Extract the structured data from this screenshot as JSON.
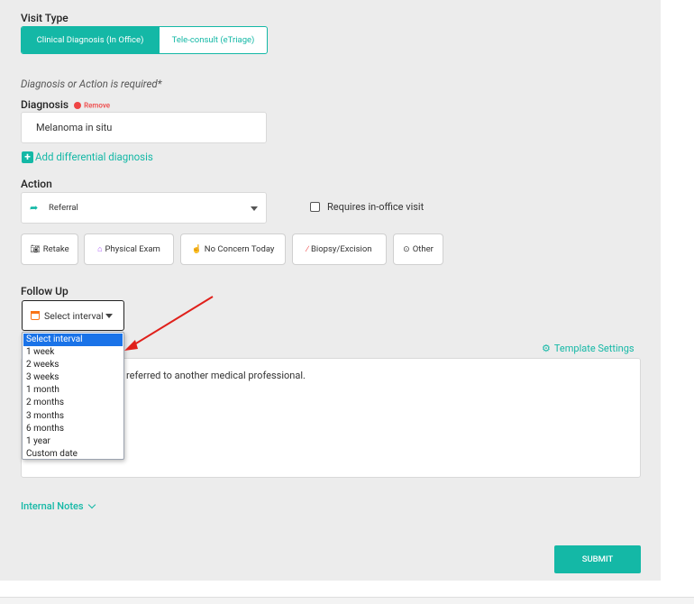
{
  "visit_type": {
    "label": "Visit Type",
    "options": [
      "Clinical Diagnosis (In Office)",
      "Tele-consult (eTriage)"
    ],
    "selected": "Clinical Diagnosis (In Office)"
  },
  "requirement_note": "Diagnosis or Action is required*",
  "diagnosis": {
    "label": "Diagnosis",
    "remove_label": "Remove",
    "value": "Melanoma in situ",
    "add_differential_label": "Add differential diagnosis"
  },
  "action": {
    "label": "Action",
    "selected": "Referral",
    "requires_in_office_label": "Requires in-office visit",
    "requires_in_office_checked": false,
    "quick_actions": [
      "Retake",
      "Physical Exam",
      "No Concern Today",
      "Biopsy/Excision",
      "Other"
    ]
  },
  "follow_up": {
    "label": "Follow Up",
    "selected": "Select interval",
    "options": [
      "Select interval",
      "1 week",
      "2 weeks",
      "3 weeks",
      "1 month",
      "2 months",
      "3 months",
      "6 months",
      "1 year",
      "Custom date"
    ]
  },
  "template_settings_label": "Template Settings",
  "message_text": "referred to another medical professional.",
  "internal_notes_label": "Internal Notes",
  "submit_label": "SUBMIT",
  "colors": {
    "accent": "#14b8a6",
    "danger": "#ef4444",
    "selection": "#1a73e8",
    "panel_bg": "#ececec"
  }
}
